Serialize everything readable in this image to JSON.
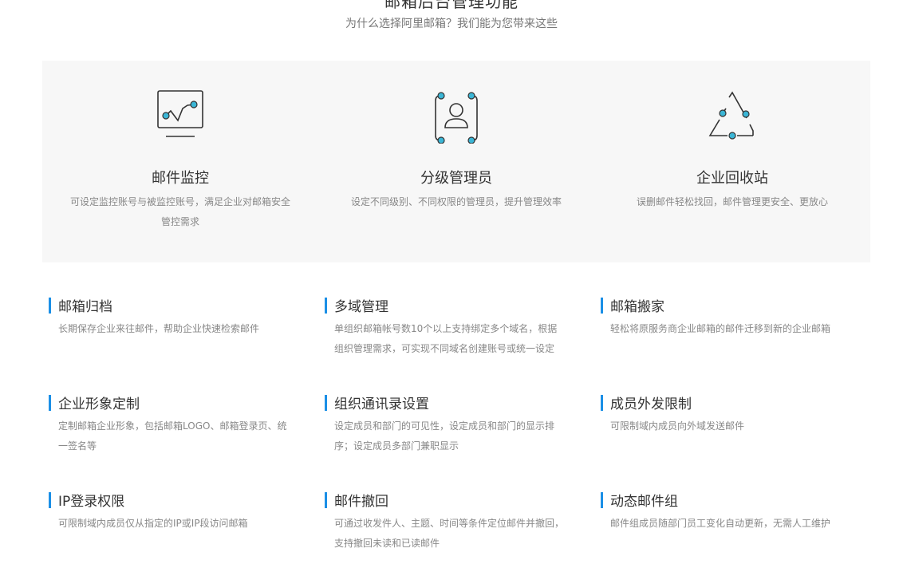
{
  "header": {
    "title": "邮箱后台管理功能",
    "subtitle": "为什么选择阿里邮箱？我们能为您带来这些"
  },
  "features": [
    {
      "icon": "monitor-chart-icon",
      "name": "邮件监控",
      "desc": "可设定监控账号与被监控账号，满足企业对邮箱安全管控需求"
    },
    {
      "icon": "admin-user-icon",
      "name": "分级管理员",
      "desc": "设定不同级别、不同权限的管理员，提升管理效率"
    },
    {
      "icon": "recycle-triangle-icon",
      "name": "企业回收站",
      "desc": "误删邮件轻松找回，邮件管理更安全、更放心"
    }
  ],
  "items": [
    {
      "name": "邮箱归档",
      "desc": "长期保存企业来往邮件，帮助企业快速检索邮件"
    },
    {
      "name": "多域管理",
      "desc": "单组织邮箱帐号数10个以上支持绑定多个域名，根据组织管理需求，可实现不同域名创建账号或统一设定"
    },
    {
      "name": "邮箱搬家",
      "desc": "轻松将原服务商企业邮箱的邮件迁移到新的企业邮箱"
    },
    {
      "name": "企业形象定制",
      "desc": "定制邮箱企业形象，包括邮箱LOGO、邮箱登录页、统一签名等"
    },
    {
      "name": "组织通讯录设置",
      "desc": "设定成员和部门的可见性，设定成员和部门的显示排序；设定成员多部门兼职显示"
    },
    {
      "name": "成员外发限制",
      "desc": "可限制域内成员向外域发送邮件"
    },
    {
      "name": "IP登录权限",
      "desc": "可限制域内成员仅从指定的IP或IP段访问邮箱"
    },
    {
      "name": "邮件撤回",
      "desc": "可通过收发件人、主题、时间等条件定位邮件并撤回，支持撤回未读和已读邮件"
    },
    {
      "name": "动态邮件组",
      "desc": "邮件组成员随部门员工变化自动更新，无需人工维护"
    }
  ],
  "colors": {
    "accent": "#1b8fe6",
    "icon_dot": "#3bb6d6",
    "panel_bg": "#f7f7f7"
  }
}
